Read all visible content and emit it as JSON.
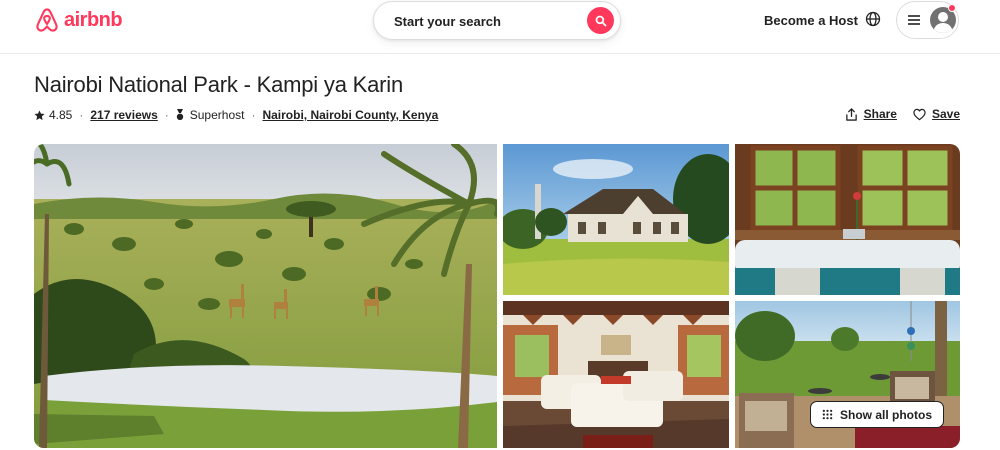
{
  "header": {
    "logo_text": "airbnb",
    "search_label": "Start your search",
    "host_link": "Become a Host",
    "icons": {
      "logo": "airbnb-logo-icon",
      "search": "search-icon",
      "globe": "globe-icon",
      "menu": "hamburger-icon",
      "avatar": "user-avatar-icon"
    }
  },
  "listing": {
    "title": "Nairobi National Park - Kampi ya Karin",
    "rating": "4.85",
    "reviews": "217 reviews",
    "host_badge": "Superhost",
    "location": "Nairobi, Nairobi County, Kenya",
    "separator": "·"
  },
  "actions": {
    "share_label": "Share",
    "save_label": "Save"
  },
  "gallery": {
    "photos": [
      {
        "name": "savanna-waterhole-photo"
      },
      {
        "name": "lodge-house-photo"
      },
      {
        "name": "bathtub-window-photo"
      },
      {
        "name": "living-room-photo"
      },
      {
        "name": "garden-veranda-photo"
      }
    ],
    "show_all_label": "Show all photos"
  },
  "colors": {
    "brand": "#ff385c",
    "text": "#222222",
    "muted": "#717171",
    "border": "#dddddd"
  }
}
